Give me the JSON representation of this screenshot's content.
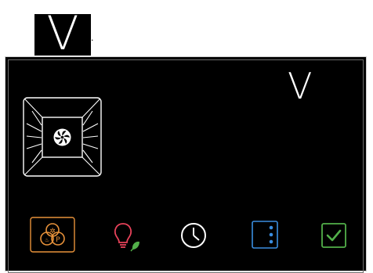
{
  "header": {
    "fragment_text": "",
    "mark_letter": "V",
    "mark_dot": "."
  },
  "display": {
    "mode_letter": "V",
    "oven_program": "convection-fan",
    "colors": {
      "background": "#000000",
      "orange": "#e8923a",
      "pink": "#e8425a",
      "green": "#52b04a",
      "white": "#ffffff",
      "blue": "#3a8ee0"
    }
  },
  "toolbar": {
    "buttons": [
      {
        "name": "special-programs-button",
        "icon": "special-programs-icon",
        "selected": true
      },
      {
        "name": "eco-light-button",
        "icon": "eco-light-icon",
        "selected": false
      },
      {
        "name": "timer-button",
        "icon": "clock-icon",
        "selected": false
      },
      {
        "name": "options-menu-button",
        "icon": "vertical-dots-icon",
        "selected": false
      },
      {
        "name": "confirm-button",
        "icon": "checkmark-icon",
        "selected": false
      }
    ]
  }
}
